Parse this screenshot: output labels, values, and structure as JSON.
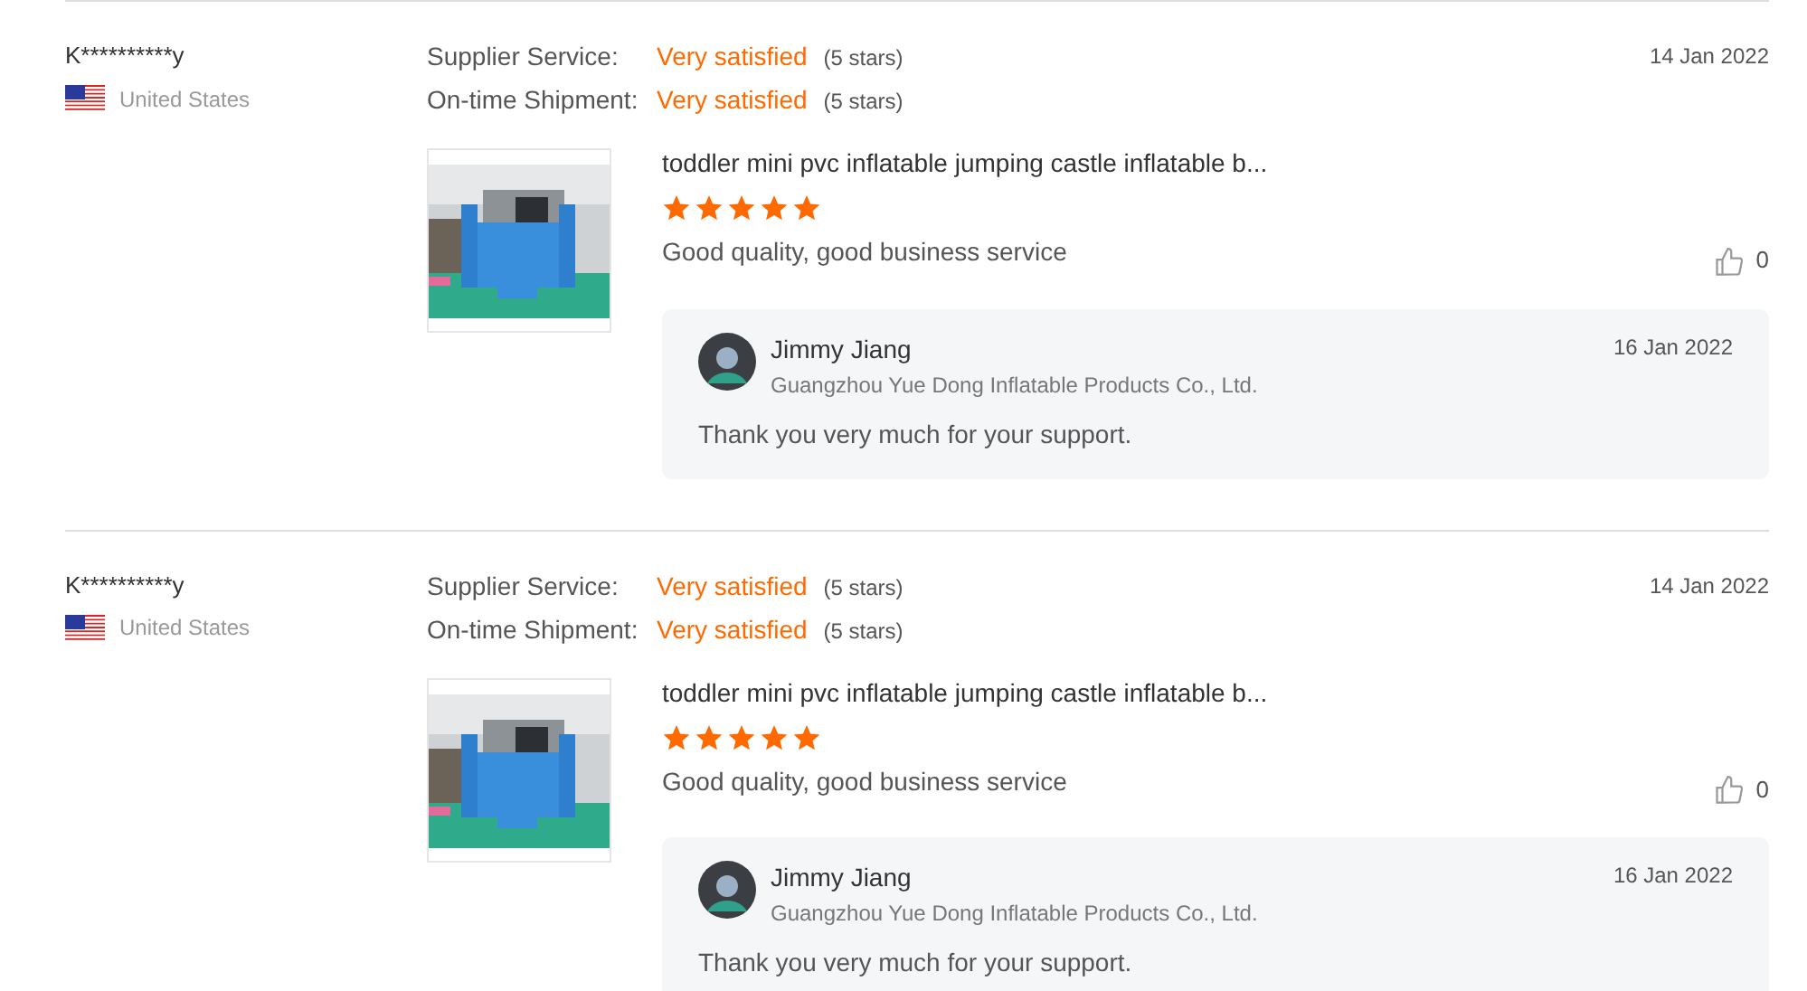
{
  "reviews": [
    {
      "reviewer": "K**********y",
      "country": "United States",
      "ratings": [
        {
          "label": "Supplier Service:",
          "value": "Very satisfied",
          "note": "(5 stars)"
        },
        {
          "label": "On-time Shipment:",
          "value": "Very satisfied",
          "note": "(5 stars)"
        }
      ],
      "date": "14 Jan 2022",
      "product": {
        "kind": "picture",
        "title": "toddler mini pvc inflatable jumping castle inflatable b..."
      },
      "stars": 5,
      "comment": "Good quality, good business service",
      "likes": "0",
      "reply": {
        "name": "Jimmy Jiang",
        "company": "Guangzhou Yue Dong Inflatable Products Co., Ltd.",
        "date": "16 Jan 2022",
        "text": "Thank you very much for your support."
      }
    },
    {
      "reviewer": "K**********y",
      "country": "United States",
      "ratings": [
        {
          "label": "Supplier Service:",
          "value": "Very satisfied",
          "note": "(5 stars)"
        },
        {
          "label": "On-time Shipment:",
          "value": "Very satisfied",
          "note": "(5 stars)"
        }
      ],
      "date": "14 Jan 2022",
      "product": {
        "kind": "picture",
        "title": "toddler mini pvc inflatable jumping castle inflatable b..."
      },
      "stars": 5,
      "comment": "Good quality, good business service",
      "likes": "0",
      "reply": {
        "name": "Jimmy Jiang",
        "company": "Guangzhou Yue Dong Inflatable Products Co., Ltd.",
        "date": "16 Jan 2022",
        "text": "Thank you very much for your support."
      }
    }
  ]
}
